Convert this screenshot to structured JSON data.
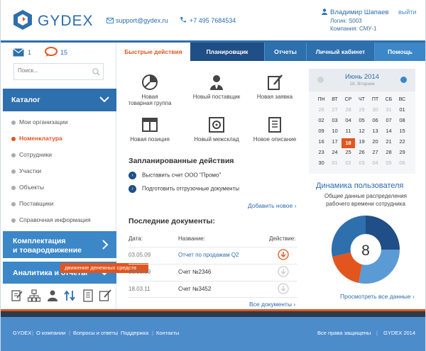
{
  "header": {
    "logo_text": "GYDEX",
    "email": "support@gydex.ru",
    "phone": "+7 495 7684534",
    "user_name": "Владимир Шапаев",
    "logout_label": "выйти",
    "login": "Логин: S003",
    "company": "Компания: СМУ-1"
  },
  "sidebar": {
    "messages_count": "1",
    "comments_count": "15",
    "search_placeholder": "Поиск...",
    "catalog_label": "Каталог",
    "catalog_items": [
      {
        "label": "Мои организации"
      },
      {
        "label": "Номенклатура"
      },
      {
        "label": "Сотрудники"
      },
      {
        "label": "Участки"
      },
      {
        "label": "Объекты"
      },
      {
        "label": "Поставщики"
      },
      {
        "label": "Справочная информация"
      }
    ],
    "completion_label_1": "Комплектация",
    "completion_label_2": "и товародвижение",
    "analytics_label": "Аналитика и отчеты",
    "tooltip": "движение денежных средств"
  },
  "tabs": [
    {
      "label": "Быстрые действия"
    },
    {
      "label": "Планировщик"
    },
    {
      "label": "Отчеты"
    },
    {
      "label": "Личный кабинет"
    },
    {
      "label": "Помощь"
    }
  ],
  "quick_actions": [
    {
      "label_1": "Новая",
      "label_2": "товарная группа",
      "icon": "pie-chart-icon"
    },
    {
      "label_1": "Новый поставщик",
      "label_2": "",
      "icon": "person-icon"
    },
    {
      "label_1": "Новая заявка",
      "label_2": "",
      "icon": "edit-document-icon"
    },
    {
      "label_1": "Новая позиция",
      "label_2": "",
      "icon": "window-icon"
    },
    {
      "label_1": "Новый межсклад",
      "label_2": "",
      "icon": "safe-icon"
    },
    {
      "label_1": "Новое описание",
      "label_2": "",
      "icon": "document-list-icon"
    }
  ],
  "planned": {
    "title": "Запланированные действия",
    "items": [
      {
        "label": "Выставить счет ООО \"Промо\""
      },
      {
        "label": "Подготовить отгрузочные документы"
      }
    ],
    "add_new": "Добавить новое"
  },
  "documents": {
    "title": "Последние документы:",
    "col_date": "Дата:",
    "col_name": "Название:",
    "col_action": "Действие:",
    "rows": [
      {
        "date": "03.05.09",
        "name": "Отчет по продажам Q2",
        "active": true
      },
      {
        "date": "08.05.09",
        "name": "Счет №2346",
        "active": false
      },
      {
        "date": "18.03.11",
        "name": "Счет №3452",
        "active": false
      }
    ],
    "all_docs": "Все документы"
  },
  "calendar": {
    "month": "Июнь 2014",
    "subtitle": "18, Вторник",
    "weekdays": [
      "ПН",
      "ВТ",
      "СР",
      "ЧТ",
      "ПТ",
      "СБ",
      "ВС"
    ],
    "weeks": [
      [
        "26",
        "27",
        "28",
        "29",
        "30",
        "31",
        "01"
      ],
      [
        "02",
        "03",
        "04",
        "05",
        "06",
        "07",
        "08"
      ],
      [
        "09",
        "10",
        "11",
        "12",
        "13",
        "14",
        "15"
      ],
      [
        "16",
        "17",
        "18",
        "19",
        "20",
        "21",
        "22"
      ],
      [
        "23",
        "24",
        "25",
        "26",
        "27",
        "28",
        "29"
      ],
      [
        "30",
        "01",
        "02",
        "03",
        "04",
        "05",
        "06"
      ]
    ],
    "today": "18"
  },
  "dynamics": {
    "title": "Динамика пользователя",
    "subtitle_1": "Общие данные распределения",
    "subtitle_2": "рабочего времени сотрудника",
    "center_value": "8",
    "see_all": "Просмотреть все данные",
    "colors": {
      "dark": "#1f4f86",
      "mid": "#2e6fad",
      "light": "#5b9bd5",
      "accent": "#e2551e"
    }
  },
  "footer": {
    "links": [
      {
        "label": "GYDEX"
      },
      {
        "label": "О компании"
      },
      {
        "label": "Вопросы и ответы"
      },
      {
        "label": "Поддержка"
      },
      {
        "label": "Контакты"
      }
    ],
    "rights": "Все права защищены",
    "copyright": "GYDEX 2014"
  },
  "colors": {
    "brand": "#2e6fad",
    "accent": "#e2551e",
    "dark": "#2b3b4c"
  }
}
